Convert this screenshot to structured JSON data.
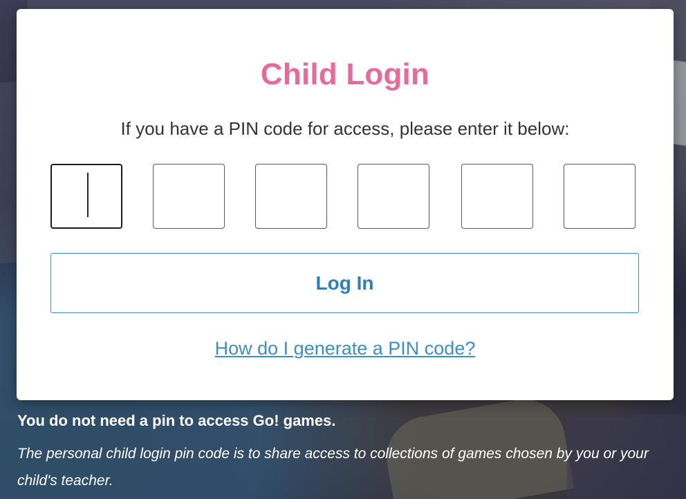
{
  "modal": {
    "title": "Child Login",
    "subtitle": "If you have a PIN code for access, please enter it below:",
    "pin_digits": [
      "",
      "",
      "",
      "",
      "",
      ""
    ],
    "login_label": "Log In",
    "help_link": "How do I generate a PIN code?"
  },
  "note": {
    "title": "You do not need a pin to access Go! games.",
    "body": "The personal child login pin code is to share access to collections of games chosen by you or your child's teacher."
  },
  "colors": {
    "title_pink": "#e8699a",
    "link_blue": "#3a90c6",
    "button_border": "#3a8fc6"
  }
}
